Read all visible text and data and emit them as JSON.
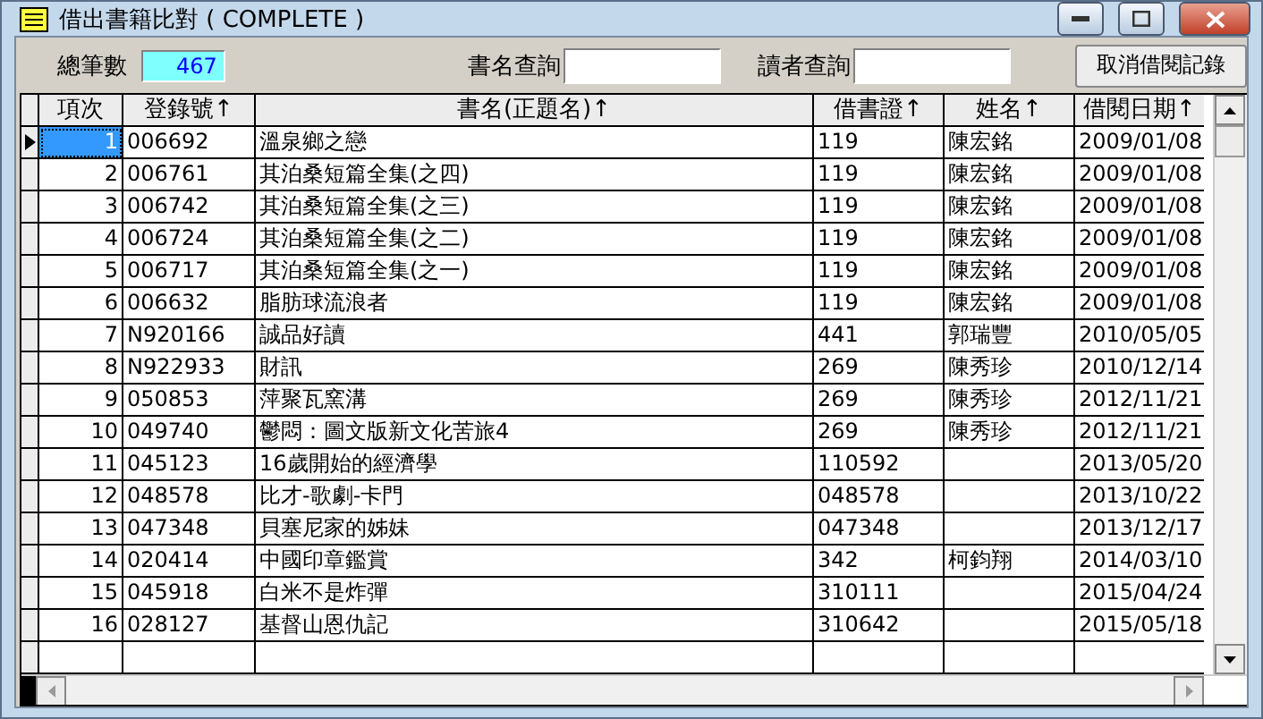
{
  "window": {
    "title": "借出書籍比對 ( COMPLETE )"
  },
  "toolbar": {
    "total_label": "總筆數",
    "total_value": "467",
    "title_search_label": "書名查詢",
    "reader_search_label": "讀者查詢",
    "cancel_button": "取消借閱記錄"
  },
  "table": {
    "columns": [
      "項次",
      "登錄號↑",
      "書名(正題名)↑",
      "借書證↑",
      "姓名↑",
      "借閱日期↑"
    ],
    "rows": [
      {
        "cells": [
          "1",
          "006692",
          "溫泉鄉之戀",
          "119",
          "陳宏銘",
          "2009/01/08"
        ],
        "selected": true
      },
      {
        "cells": [
          "2",
          "006761",
          "其泊桑短篇全集(之四)",
          "119",
          "陳宏銘",
          "2009/01/08"
        ],
        "selected": false
      },
      {
        "cells": [
          "3",
          "006742",
          "其泊桑短篇全集(之三)",
          "119",
          "陳宏銘",
          "2009/01/08"
        ],
        "selected": false
      },
      {
        "cells": [
          "4",
          "006724",
          "其泊桑短篇全集(之二)",
          "119",
          "陳宏銘",
          "2009/01/08"
        ],
        "selected": false
      },
      {
        "cells": [
          "5",
          "006717",
          "其泊桑短篇全集(之一)",
          "119",
          "陳宏銘",
          "2009/01/08"
        ],
        "selected": false
      },
      {
        "cells": [
          "6",
          "006632",
          "脂肪球流浪者",
          "119",
          "陳宏銘",
          "2009/01/08"
        ],
        "selected": false
      },
      {
        "cells": [
          "7",
          "N920166",
          "誠品好讀",
          "441",
          "郭瑞豐",
          "2010/05/05"
        ],
        "selected": false
      },
      {
        "cells": [
          "8",
          "N922933",
          "財訊",
          "269",
          "陳秀珍",
          "2010/12/14"
        ],
        "selected": false
      },
      {
        "cells": [
          "9",
          "050853",
          "萍聚瓦窯溝",
          "269",
          "陳秀珍",
          "2012/11/21"
        ],
        "selected": false
      },
      {
        "cells": [
          "10",
          "049740",
          "鬱悶：圖文版新文化苦旅4",
          "269",
          "陳秀珍",
          "2012/11/21"
        ],
        "selected": false
      },
      {
        "cells": [
          "11",
          "045123",
          "16歲開始的經濟學",
          "110592",
          "",
          "2013/05/20"
        ],
        "selected": false
      },
      {
        "cells": [
          "12",
          "048578",
          "比才-歌劇-卡門",
          "048578",
          "",
          "2013/10/22"
        ],
        "selected": false
      },
      {
        "cells": [
          "13",
          "047348",
          "貝塞尼家的姊妹",
          "047348",
          "",
          "2013/12/17"
        ],
        "selected": false
      },
      {
        "cells": [
          "14",
          "020414",
          "中國印章鑑賞",
          "342",
          "柯鈞翔",
          "2014/03/10"
        ],
        "selected": false
      },
      {
        "cells": [
          "15",
          "045918",
          "白米不是炸彈",
          "310111",
          "",
          "2015/04/24"
        ],
        "selected": false
      },
      {
        "cells": [
          "16",
          "028127",
          "基督山恩仇記",
          "310642",
          "",
          "2015/05/18"
        ],
        "selected": false
      }
    ]
  }
}
